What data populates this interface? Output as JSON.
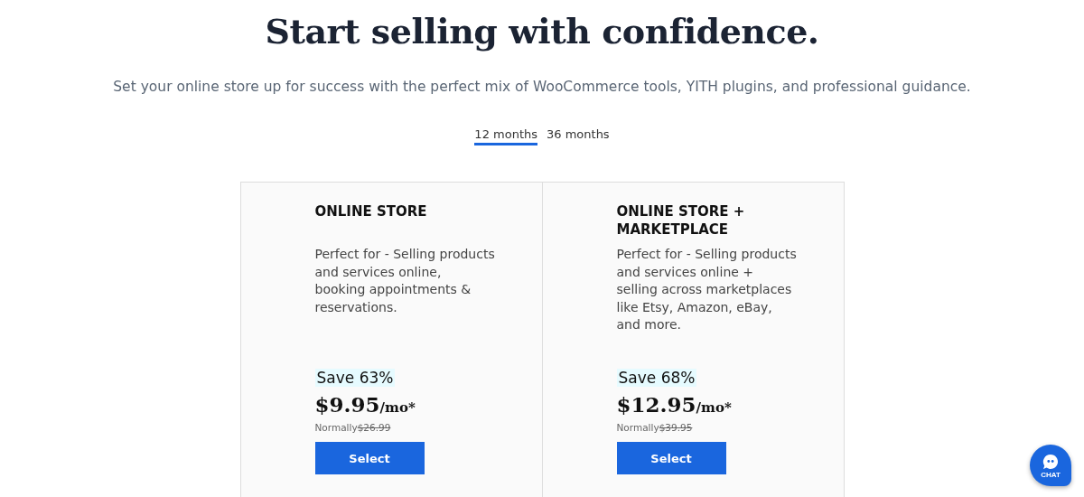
{
  "heading": "Start selling with confidence.",
  "subtitle": "Set your online store up for success with the perfect mix of WooCommerce tools, YITH plugins, and professional guidance.",
  "tabs": [
    {
      "label": "12 months",
      "selected": true
    },
    {
      "label": "36 months",
      "selected": false
    }
  ],
  "plans": [
    {
      "name": "ONLINE STORE",
      "description": "Perfect for - Selling products and services online, booking appointments & reservations.",
      "save": "Save 63%",
      "price": "$9.95",
      "unit": "/mo*",
      "normally": "Normally",
      "normal_price": "$26.99",
      "button": "Select"
    },
    {
      "name": "ONLINE STORE + MARKETPLACE",
      "description": "Perfect for - Selling products and services online + selling across marketplaces like Etsy, Amazon, eBay, and more.",
      "save": "Save 68%",
      "price": "$12.95",
      "unit": "/mo*",
      "normally": "Normally",
      "normal_price": "$39.95",
      "button": "Select"
    }
  ],
  "chat": {
    "label": "CHAT"
  }
}
